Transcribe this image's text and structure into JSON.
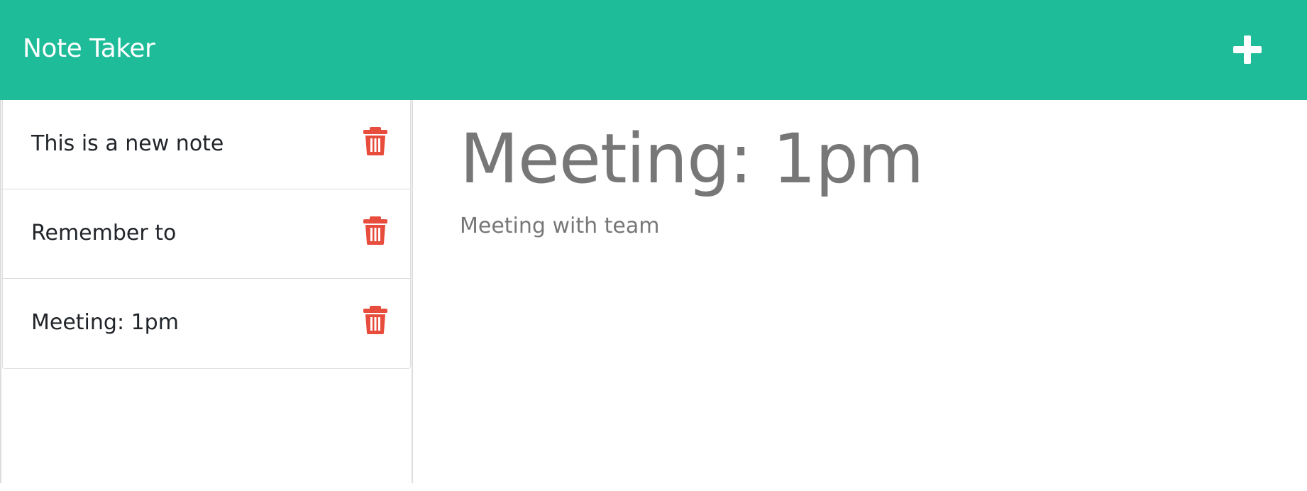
{
  "header": {
    "title": "Note Taker",
    "add_icon": "plus-icon",
    "background_color": "#1fbc99"
  },
  "sidebar": {
    "notes": [
      {
        "title": "This is a new note",
        "delete_icon": "trash-icon"
      },
      {
        "title": "Remember to",
        "delete_icon": "trash-icon"
      },
      {
        "title": "Meeting: 1pm",
        "delete_icon": "trash-icon"
      }
    ],
    "delete_icon_color": "#e74c3c"
  },
  "editor": {
    "title": "Meeting: 1pm",
    "text": "Meeting with team",
    "text_color": "#777777"
  }
}
